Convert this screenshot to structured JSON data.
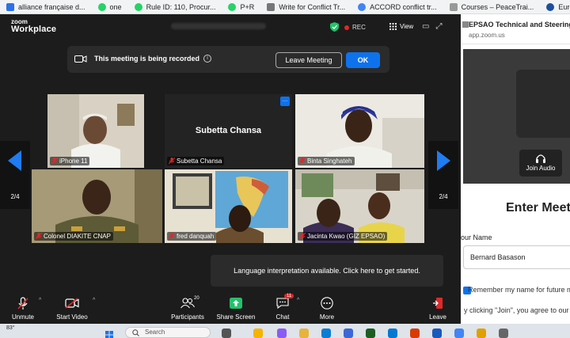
{
  "browser": {
    "bookmarks": [
      {
        "label": "alliance française d...",
        "color": "#2b72e8"
      },
      {
        "label": "one",
        "color": "#25d366",
        "round": true
      },
      {
        "label": "Rule ID: 110, Procur...",
        "color": "#25d366",
        "round": true
      },
      {
        "label": "P+R",
        "color": "#25d366",
        "round": true
      },
      {
        "label": "Write for Conflict Tr...",
        "color": "#777777"
      },
      {
        "label": "ACCORD conflict tr...",
        "color": "#4285f4",
        "round": true
      },
      {
        "label": "Courses – PeaceTrai...",
        "color": "#999999"
      },
      {
        "label": "European Commis",
        "color": "#1f4e9e",
        "round": true
      }
    ]
  },
  "zoom": {
    "logo_line1": "zoom",
    "logo_line2": "Workplace",
    "recording_indicator": "REC",
    "view_label": "View",
    "banner": {
      "message": "This meeting is being recorded",
      "leave_label": "Leave Meeting",
      "ok_label": "OK"
    },
    "participants": [
      {
        "name": "iPhone 11"
      },
      {
        "name": "Subetta Chansa",
        "center_name": "Subetta Chansa"
      },
      {
        "name": "Binta Singhateh"
      },
      {
        "name": "Colonel DIAKITE CNAP"
      },
      {
        "name": "fred danquah"
      },
      {
        "name": "Jacinta Kwao (GIZ EPSAO)"
      }
    ],
    "page_left": "2/4",
    "page_right": "2/4",
    "interpretation_toast": "Language interpretation available. Click here to get started.",
    "toolbar": {
      "unmute": "Unmute",
      "start_video": "Start Video",
      "participants": "Participants",
      "participants_count": "20",
      "share_screen": "Share Screen",
      "chat": "Chat",
      "chat_badge": "11",
      "more": "More",
      "leave": "Leave"
    }
  },
  "side_panel": {
    "tab_title": "EPSAO Technical and Steering",
    "url": "app.zoom.us",
    "join_audio": "Join Audio",
    "heading": "Enter Meeting",
    "name_label": "our Name",
    "name_value": "Bernard Basason",
    "remember": "Remember my name for future meetings",
    "agree": "y clicking \"Join\", you agree to our"
  },
  "taskbar": {
    "weather": "83°",
    "search_placeholder": "Search"
  }
}
